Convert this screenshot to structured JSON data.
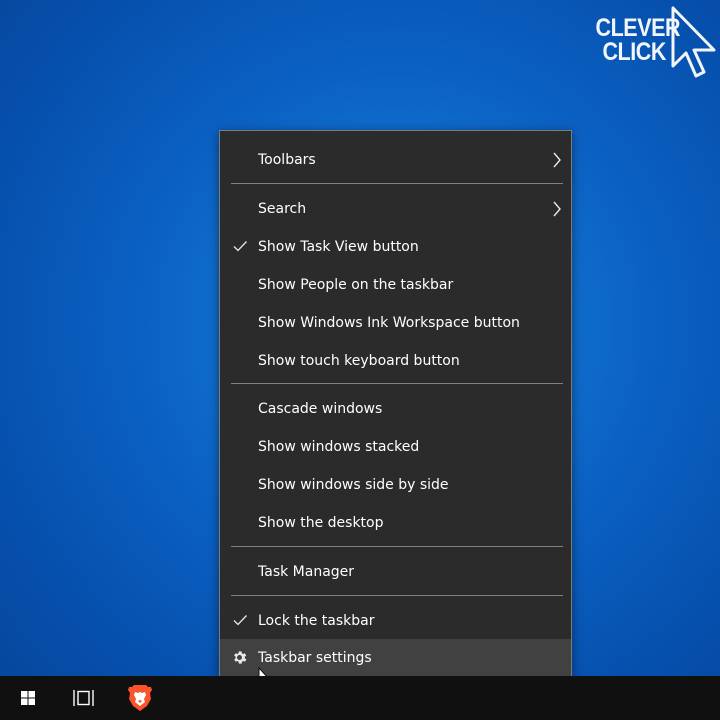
{
  "watermark": {
    "line1": "CLEVER",
    "line2": "CLICK",
    "icon": "cursor-arrow-icon"
  },
  "menu": {
    "items": [
      {
        "label": "Toolbars",
        "checked": false,
        "submenu": true
      },
      {
        "label": "Search",
        "checked": false,
        "submenu": true
      },
      {
        "label": "Show Task View button",
        "checked": true,
        "submenu": false
      },
      {
        "label": "Show People on the taskbar",
        "checked": false,
        "submenu": false
      },
      {
        "label": "Show Windows Ink Workspace button",
        "checked": false,
        "submenu": false
      },
      {
        "label": "Show touch keyboard button",
        "checked": false,
        "submenu": false
      },
      {
        "label": "Cascade windows",
        "checked": false,
        "submenu": false
      },
      {
        "label": "Show windows stacked",
        "checked": false,
        "submenu": false
      },
      {
        "label": "Show windows side by side",
        "checked": false,
        "submenu": false
      },
      {
        "label": "Show the desktop",
        "checked": false,
        "submenu": false
      },
      {
        "label": "Task Manager",
        "checked": false,
        "submenu": false
      },
      {
        "label": "Lock the taskbar",
        "checked": true,
        "submenu": false
      },
      {
        "label": "Taskbar settings",
        "checked": false,
        "submenu": false,
        "icon": "gear-icon",
        "highlighted": true
      }
    ]
  },
  "taskbar": {
    "buttons": [
      {
        "name": "start-button",
        "icon": "windows-logo-icon"
      },
      {
        "name": "task-view-button",
        "icon": "task-view-icon"
      },
      {
        "name": "brave-browser-button",
        "icon": "brave-lion-icon"
      }
    ]
  },
  "colors": {
    "menu_bg": "#2b2b2b",
    "menu_hover": "#414141",
    "menu_border": "#7b7b7b",
    "taskbar_bg": "#101010",
    "desktop_blue": "#0b62c4",
    "brave_orange": "#fb542b"
  }
}
